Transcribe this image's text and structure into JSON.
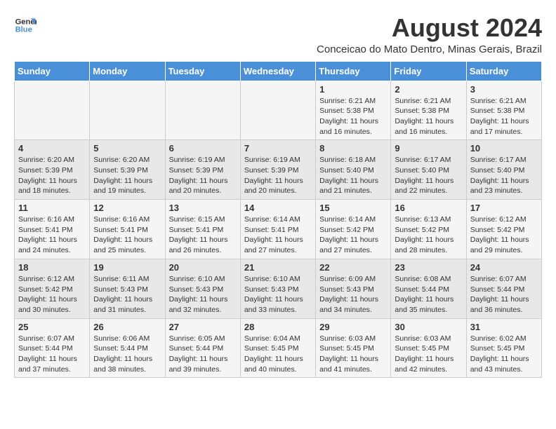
{
  "logo": {
    "line1": "General",
    "line2": "Blue"
  },
  "title": "August 2024",
  "subtitle": "Conceicao do Mato Dentro, Minas Gerais, Brazil",
  "days_of_week": [
    "Sunday",
    "Monday",
    "Tuesday",
    "Wednesday",
    "Thursday",
    "Friday",
    "Saturday"
  ],
  "weeks": [
    [
      {
        "day": "",
        "info": ""
      },
      {
        "day": "",
        "info": ""
      },
      {
        "day": "",
        "info": ""
      },
      {
        "day": "",
        "info": ""
      },
      {
        "day": "1",
        "info": "Sunrise: 6:21 AM\nSunset: 5:38 PM\nDaylight: 11 hours\nand 16 minutes."
      },
      {
        "day": "2",
        "info": "Sunrise: 6:21 AM\nSunset: 5:38 PM\nDaylight: 11 hours\nand 16 minutes."
      },
      {
        "day": "3",
        "info": "Sunrise: 6:21 AM\nSunset: 5:38 PM\nDaylight: 11 hours\nand 17 minutes."
      }
    ],
    [
      {
        "day": "4",
        "info": "Sunrise: 6:20 AM\nSunset: 5:39 PM\nDaylight: 11 hours\nand 18 minutes."
      },
      {
        "day": "5",
        "info": "Sunrise: 6:20 AM\nSunset: 5:39 PM\nDaylight: 11 hours\nand 19 minutes."
      },
      {
        "day": "6",
        "info": "Sunrise: 6:19 AM\nSunset: 5:39 PM\nDaylight: 11 hours\nand 20 minutes."
      },
      {
        "day": "7",
        "info": "Sunrise: 6:19 AM\nSunset: 5:39 PM\nDaylight: 11 hours\nand 20 minutes."
      },
      {
        "day": "8",
        "info": "Sunrise: 6:18 AM\nSunset: 5:40 PM\nDaylight: 11 hours\nand 21 minutes."
      },
      {
        "day": "9",
        "info": "Sunrise: 6:17 AM\nSunset: 5:40 PM\nDaylight: 11 hours\nand 22 minutes."
      },
      {
        "day": "10",
        "info": "Sunrise: 6:17 AM\nSunset: 5:40 PM\nDaylight: 11 hours\nand 23 minutes."
      }
    ],
    [
      {
        "day": "11",
        "info": "Sunrise: 6:16 AM\nSunset: 5:41 PM\nDaylight: 11 hours\nand 24 minutes."
      },
      {
        "day": "12",
        "info": "Sunrise: 6:16 AM\nSunset: 5:41 PM\nDaylight: 11 hours\nand 25 minutes."
      },
      {
        "day": "13",
        "info": "Sunrise: 6:15 AM\nSunset: 5:41 PM\nDaylight: 11 hours\nand 26 minutes."
      },
      {
        "day": "14",
        "info": "Sunrise: 6:14 AM\nSunset: 5:41 PM\nDaylight: 11 hours\nand 27 minutes."
      },
      {
        "day": "15",
        "info": "Sunrise: 6:14 AM\nSunset: 5:42 PM\nDaylight: 11 hours\nand 27 minutes."
      },
      {
        "day": "16",
        "info": "Sunrise: 6:13 AM\nSunset: 5:42 PM\nDaylight: 11 hours\nand 28 minutes."
      },
      {
        "day": "17",
        "info": "Sunrise: 6:12 AM\nSunset: 5:42 PM\nDaylight: 11 hours\nand 29 minutes."
      }
    ],
    [
      {
        "day": "18",
        "info": "Sunrise: 6:12 AM\nSunset: 5:42 PM\nDaylight: 11 hours\nand 30 minutes."
      },
      {
        "day": "19",
        "info": "Sunrise: 6:11 AM\nSunset: 5:43 PM\nDaylight: 11 hours\nand 31 minutes."
      },
      {
        "day": "20",
        "info": "Sunrise: 6:10 AM\nSunset: 5:43 PM\nDaylight: 11 hours\nand 32 minutes."
      },
      {
        "day": "21",
        "info": "Sunrise: 6:10 AM\nSunset: 5:43 PM\nDaylight: 11 hours\nand 33 minutes."
      },
      {
        "day": "22",
        "info": "Sunrise: 6:09 AM\nSunset: 5:43 PM\nDaylight: 11 hours\nand 34 minutes."
      },
      {
        "day": "23",
        "info": "Sunrise: 6:08 AM\nSunset: 5:44 PM\nDaylight: 11 hours\nand 35 minutes."
      },
      {
        "day": "24",
        "info": "Sunrise: 6:07 AM\nSunset: 5:44 PM\nDaylight: 11 hours\nand 36 minutes."
      }
    ],
    [
      {
        "day": "25",
        "info": "Sunrise: 6:07 AM\nSunset: 5:44 PM\nDaylight: 11 hours\nand 37 minutes."
      },
      {
        "day": "26",
        "info": "Sunrise: 6:06 AM\nSunset: 5:44 PM\nDaylight: 11 hours\nand 38 minutes."
      },
      {
        "day": "27",
        "info": "Sunrise: 6:05 AM\nSunset: 5:44 PM\nDaylight: 11 hours\nand 39 minutes."
      },
      {
        "day": "28",
        "info": "Sunrise: 6:04 AM\nSunset: 5:45 PM\nDaylight: 11 hours\nand 40 minutes."
      },
      {
        "day": "29",
        "info": "Sunrise: 6:03 AM\nSunset: 5:45 PM\nDaylight: 11 hours\nand 41 minutes."
      },
      {
        "day": "30",
        "info": "Sunrise: 6:03 AM\nSunset: 5:45 PM\nDaylight: 11 hours\nand 42 minutes."
      },
      {
        "day": "31",
        "info": "Sunrise: 6:02 AM\nSunset: 5:45 PM\nDaylight: 11 hours\nand 43 minutes."
      }
    ]
  ]
}
